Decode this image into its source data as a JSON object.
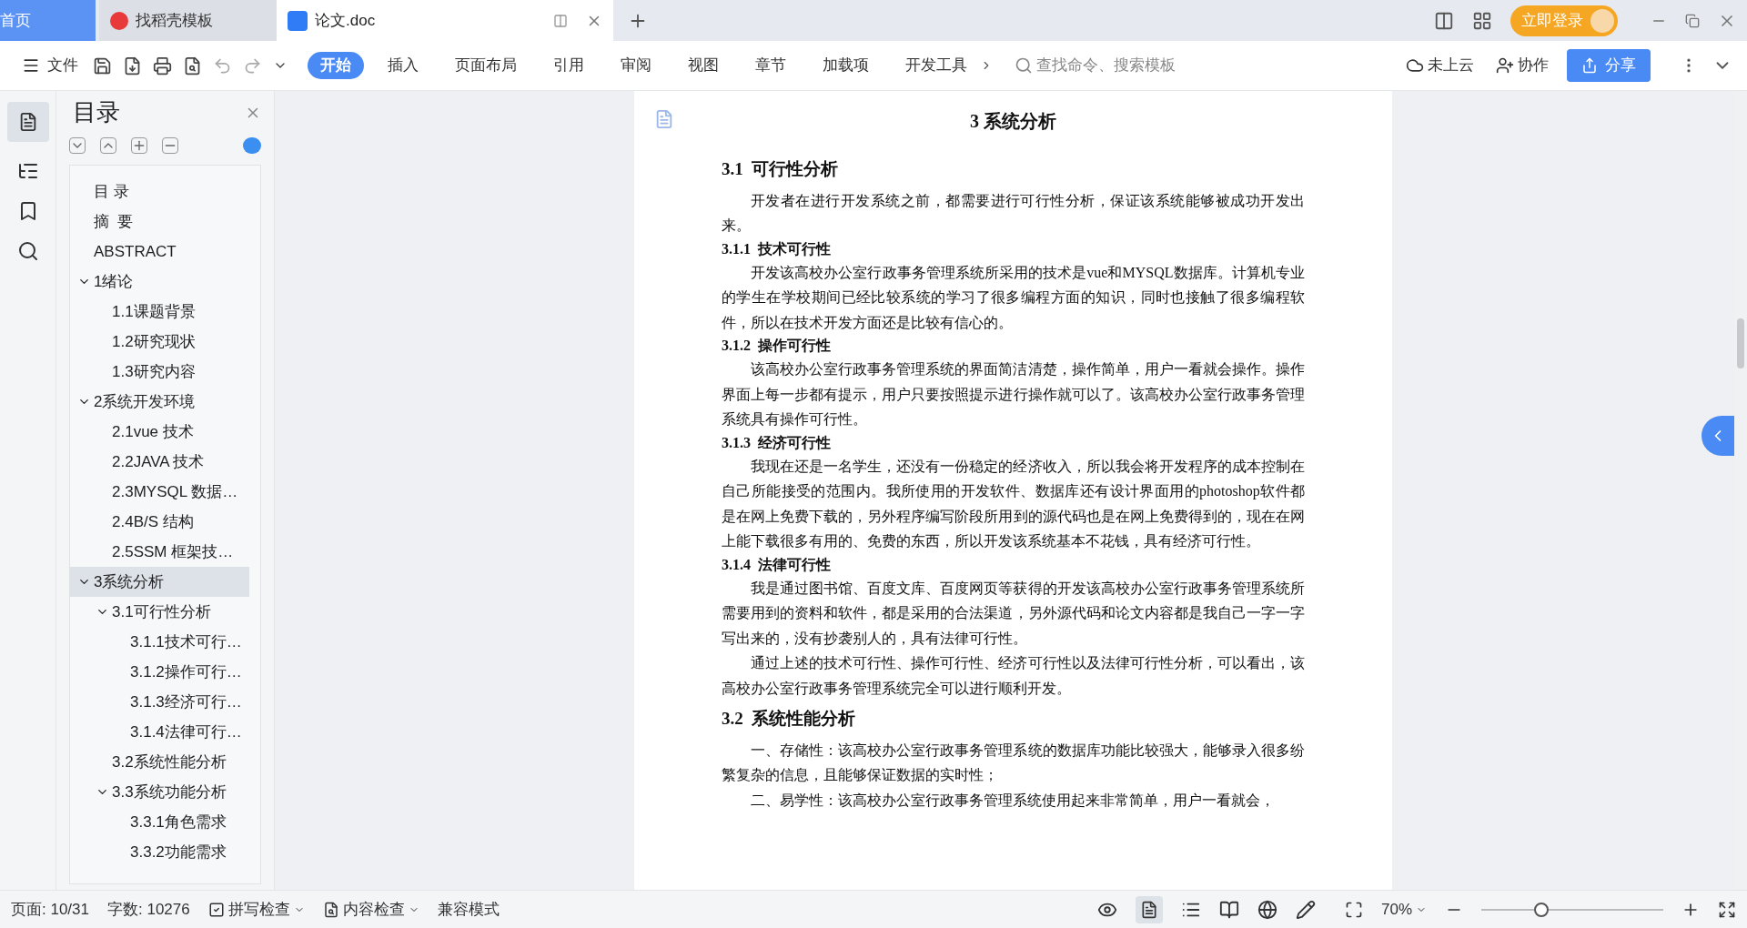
{
  "tabs": [
    {
      "label": "首页",
      "kind": "home",
      "selected": false
    },
    {
      "label": "找稻壳模板",
      "kind": "template",
      "selected": false
    },
    {
      "label": "论文.doc",
      "kind": "doc",
      "selected": true
    }
  ],
  "login_button": "立即登录",
  "file_menu": "文件",
  "ribbon_tabs": [
    {
      "label": "开始",
      "selected": true
    },
    {
      "label": "插入",
      "selected": false
    },
    {
      "label": "页面布局",
      "selected": false
    },
    {
      "label": "引用",
      "selected": false
    },
    {
      "label": "审阅",
      "selected": false
    },
    {
      "label": "视图",
      "selected": false
    },
    {
      "label": "章节",
      "selected": false
    },
    {
      "label": "加载项",
      "selected": false
    },
    {
      "label": "开发工具",
      "selected": false
    }
  ],
  "search": {
    "placeholder": "查找命令、搜索模板"
  },
  "cloud": "未上云",
  "collaborate": "协作",
  "share": "分享",
  "navigation": {
    "title": "目录",
    "items": [
      {
        "label": "目 录",
        "selected": false
      },
      {
        "label": "摘  要",
        "selected": false
      },
      {
        "label": "ABSTRACT",
        "selected": false
      },
      {
        "label": "1绪论",
        "selected": false,
        "expanded": true,
        "children": [
          {
            "label": "1.1课题背景",
            "selected": false
          },
          {
            "label": "1.2研究现状",
            "selected": false
          },
          {
            "label": "1.3研究内容",
            "selected": false
          }
        ]
      },
      {
        "label": "2系统开发环境",
        "selected": false,
        "expanded": true,
        "children": [
          {
            "label": "2.1vue 技术",
            "selected": false
          },
          {
            "label": "2.2JAVA 技术",
            "selected": false
          },
          {
            "label": "2.3MYSQL 数据…",
            "selected": false
          },
          {
            "label": "2.4B/S 结构",
            "selected": false
          },
          {
            "label": "2.5SSM 框架技…",
            "selected": false
          }
        ]
      },
      {
        "label": "3系统分析",
        "selected": true,
        "expanded": true,
        "children": [
          {
            "label": "3.1可行性分析",
            "selected": false,
            "expanded": true,
            "children": [
              {
                "label": "3.1.1技术可行…",
                "selected": false
              },
              {
                "label": "3.1.2操作可行…",
                "selected": false
              },
              {
                "label": "3.1.3经济可行…",
                "selected": false
              },
              {
                "label": "3.1.4法律可行…",
                "selected": false
              }
            ]
          },
          {
            "label": "3.2系统性能分析",
            "selected": false
          },
          {
            "label": "3.3系统功能分析",
            "selected": false,
            "expanded": true,
            "children": [
              {
                "label": "3.3.1角色需求",
                "selected": false
              },
              {
                "label": "3.3.2功能需求",
                "selected": false
              }
            ]
          }
        ]
      }
    ]
  },
  "document": {
    "title": "3  系统分析",
    "blocks": [
      {
        "kind": "h2",
        "text": "3.1  可行性分析"
      },
      {
        "kind": "p",
        "text": "开发者在进行开发系统之前，都需要进行可行性分析，保证该系统能够被成功开发出来。"
      },
      {
        "kind": "h3",
        "text": "3.1.1  技术可行性"
      },
      {
        "kind": "p",
        "text": "开发该高校办公室行政事务管理系统所采用的技术是vue和MYSQL数据库。计算机专业的学生在学校期间已经比较系统的学习了很多编程方面的知识，同时也接触了很多编程软件，所以在技术开发方面还是比较有信心的。"
      },
      {
        "kind": "h3",
        "text": "3.1.2  操作可行性"
      },
      {
        "kind": "p",
        "text": "该高校办公室行政事务管理系统的界面简洁清楚，操作简单，用户一看就会操作。操作界面上每一步都有提示，用户只要按照提示进行操作就可以了。该高校办公室行政事务管理系统具有操作可行性。"
      },
      {
        "kind": "h3",
        "text": "3.1.3  经济可行性"
      },
      {
        "kind": "p",
        "text": "我现在还是一名学生，还没有一份稳定的经济收入，所以我会将开发程序的成本控制在自己所能接受的范围内。我所使用的开发软件、数据库还有设计界面用的photoshop软件都是在网上免费下载的，另外程序编写阶段所用到的源代码也是在网上免费得到的，现在在网上能下载很多有用的、免费的东西，所以开发该系统基本不花钱，具有经济可行性。"
      },
      {
        "kind": "h3",
        "text": "3.1.4  法律可行性"
      },
      {
        "kind": "p",
        "text": "我是通过图书馆、百度文库、百度网页等获得的开发该高校办公室行政事务管理系统所需要用到的资料和软件，都是采用的合法渠道，另外源代码和论文内容都是我自己一字一字写出来的，没有抄袭别人的，具有法律可行性。"
      },
      {
        "kind": "p",
        "text": "通过上述的技术可行性、操作可行性、经济可行性以及法律可行性分析，可以看出，该高校办公室行政事务管理系统完全可以进行顺利开发。"
      },
      {
        "kind": "h2",
        "text": "3.2  系统性能分析"
      },
      {
        "kind": "p",
        "text": "一、存储性：该高校办公室行政事务管理系统的数据库功能比较强大，能够录入很多纷繁复杂的信息，且能够保证数据的实时性；"
      },
      {
        "kind": "p",
        "text": "二、易学性：该高校办公室行政事务管理系统使用起来非常简单，用户一看就会，"
      }
    ]
  },
  "status": {
    "page": "页面: 10/31",
    "words": "字数: 10276",
    "spell_check": "拼写检查",
    "content_check": "内容检查",
    "compat": "兼容模式",
    "zoom": "70%",
    "zoom_slider": {
      "level": 0.33
    }
  }
}
